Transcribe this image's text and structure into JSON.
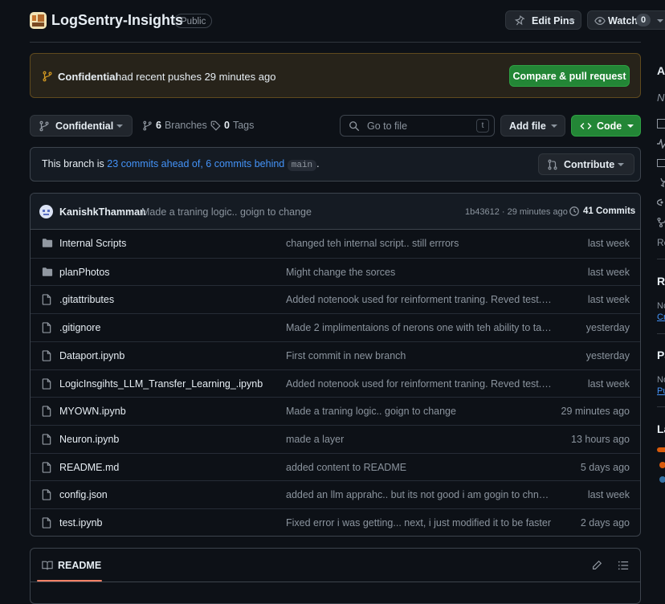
{
  "repo": {
    "name": "LogSentry-Insights",
    "visibility": "Public"
  },
  "header_actions": {
    "edit_pins": "Edit Pins",
    "watch": "Watch",
    "watch_count": "0"
  },
  "push_banner": {
    "branch": "Confidential",
    "message": "had recent pushes 29 minutes ago",
    "compare_label": "Compare & pull request"
  },
  "toolbar": {
    "branch": "Confidential",
    "branches_count": "6",
    "branches_label": "Branches",
    "tags_count": "0",
    "tags_label": "Tags",
    "search_placeholder": "Go to file",
    "search_shortcut": "t",
    "add_file": "Add file",
    "code": "Code"
  },
  "branch_status": {
    "prefix": "This branch is",
    "ahead": "23 commits ahead of,",
    "behind": "6 commits behind",
    "base": "main",
    "suffix": ".",
    "contribute": "Contribute"
  },
  "latest_commit": {
    "author": "KanishkThamman",
    "message": "Made a traning logic.. goign to change",
    "hash_time": "1b43612 · 29 minutes ago",
    "commits_label": "41 Commits"
  },
  "files": [
    {
      "type": "folder",
      "name": "Internal Scripts",
      "message": "changed teh internal script.. still errrors",
      "time": "last week"
    },
    {
      "type": "folder",
      "name": "planPhotos",
      "message": "Might change the sorces",
      "time": "last week"
    },
    {
      "type": "file",
      "name": ".gitattributes",
      "message": "Added notenook used for reinforment traning. Reved test.py...",
      "time": "last week"
    },
    {
      "type": "file",
      "name": ".gitignore",
      "message": "Made 2 implimentaions of nerons one with teh ability to tak...",
      "time": "yesterday"
    },
    {
      "type": "file",
      "name": "Dataport.ipynb",
      "message": "First commit in new branch",
      "time": "yesterday"
    },
    {
      "type": "file",
      "name": "LogicInsgihts_LLM_Transfer_Learning_.ipynb",
      "message": "Added notenook used for reinforment traning. Reved test.py...",
      "time": "last week"
    },
    {
      "type": "file",
      "name": "MYOWN.ipynb",
      "message": "Made a traning logic.. goign to change",
      "time": "29 minutes ago"
    },
    {
      "type": "file",
      "name": "Neuron.ipynb",
      "message": "made a layer",
      "time": "13 hours ago"
    },
    {
      "type": "file",
      "name": "README.md",
      "message": "added content to README",
      "time": "5 days ago"
    },
    {
      "type": "file",
      "name": "config.json",
      "message": "added an llm apprahc.. but its not good i am gogin to chnag...",
      "time": "last week"
    },
    {
      "type": "file",
      "name": "test.ipynb",
      "message": "Fixed error i was getting... next, i just modified it to be faster",
      "time": "2 days ago"
    }
  ],
  "readme": {
    "tab_label": "README"
  },
  "sidebar": {
    "about_initial": "A",
    "desc_initial": "N",
    "resources_initial": "Re",
    "releases_initial": "Re",
    "releases_sub": "No",
    "releases_link": "Cr",
    "packages_initial": "Pa",
    "packages_sub": "No",
    "packages_link": "Pu",
    "languages_initial": "La"
  },
  "colors": {
    "accent_green": "#238636",
    "link_blue": "#4493f8",
    "banner_bg": "#27231a",
    "banner_icon": "#d29922"
  }
}
